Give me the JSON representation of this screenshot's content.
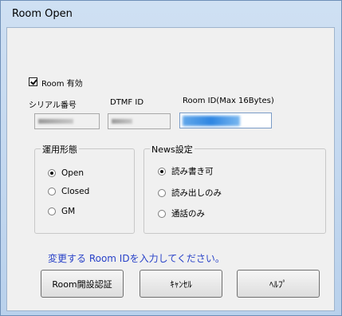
{
  "window": {
    "title": "Room Open"
  },
  "room_enable": {
    "label": "Room 有効",
    "checked": true
  },
  "fields": {
    "serial": {
      "label": "シリアル番号"
    },
    "dtmf": {
      "label": "DTMF ID"
    },
    "room_id": {
      "label": "Room ID(Max 16Bytes)"
    }
  },
  "operation_group": {
    "label": "運用形態",
    "options": [
      {
        "label": "Open",
        "selected": true
      },
      {
        "label": "Closed",
        "selected": false
      },
      {
        "label": "GM",
        "selected": false
      }
    ]
  },
  "news_group": {
    "label": "News設定",
    "options": [
      {
        "label": "読み書き可",
        "selected": true
      },
      {
        "label": "読み出しのみ",
        "selected": false
      },
      {
        "label": "通話のみ",
        "selected": false
      }
    ]
  },
  "info_message": "変更する Room IDを入力してください。",
  "buttons": {
    "auth": "Room開設認証",
    "cancel": "ｷｬﾝｾﾙ",
    "help": "ﾍﾙﾌﾟ"
  },
  "colors": {
    "info_text": "#2942c8",
    "selection": "#2f86e2"
  }
}
